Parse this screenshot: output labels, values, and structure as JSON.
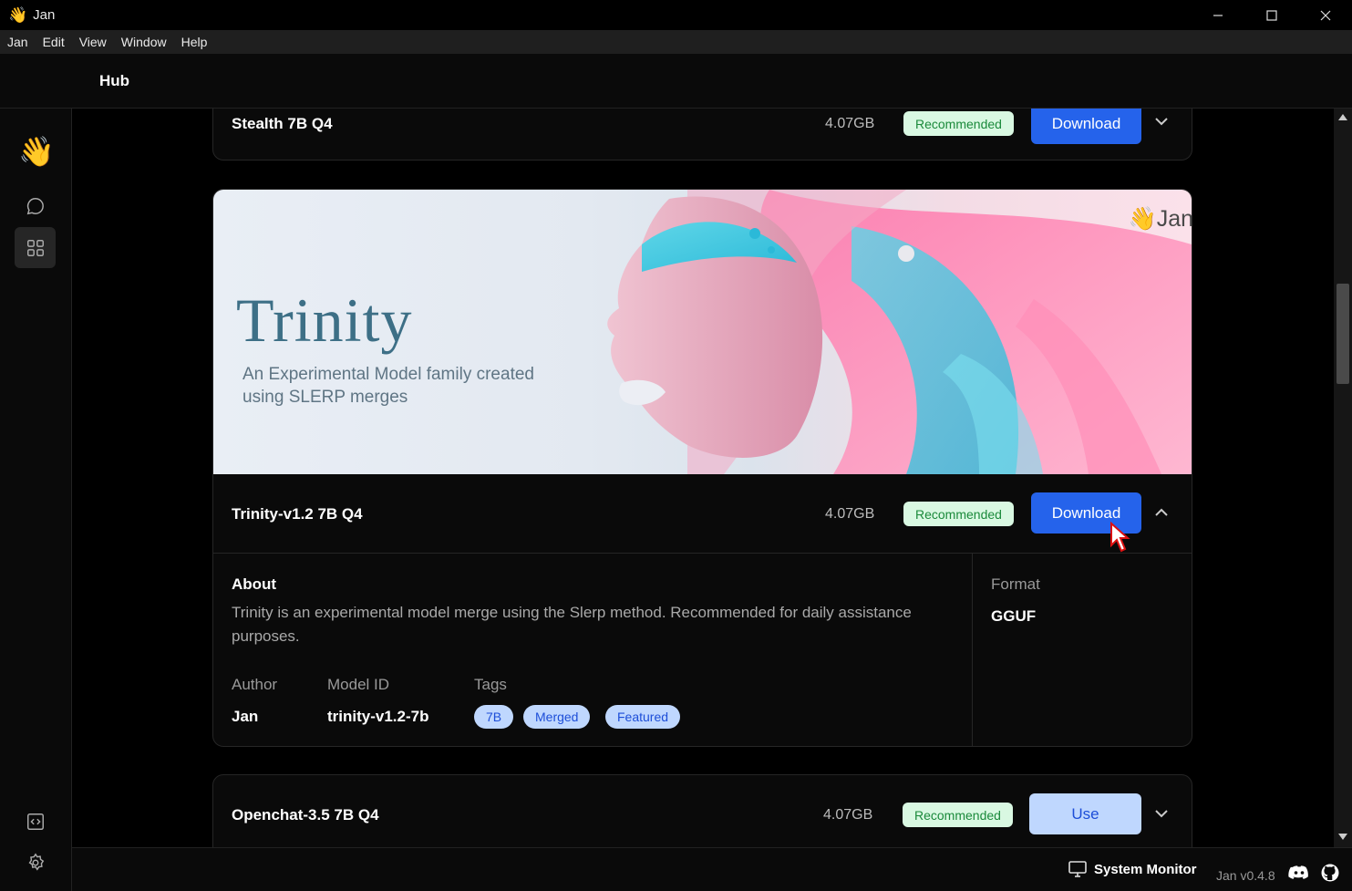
{
  "window": {
    "app_icon": "👋",
    "title": "Jan"
  },
  "menu": [
    "Jan",
    "Edit",
    "View",
    "Window",
    "Help"
  ],
  "header": {
    "title": "Hub"
  },
  "sidebar": {
    "logo": "👋",
    "items": [
      "chat-icon",
      "hub-grid-icon"
    ],
    "bottom": [
      "api-server-icon",
      "settings-gear-icon"
    ]
  },
  "models": [
    {
      "name": "Stealth 7B Q4",
      "size": "4.07GB",
      "badge": "Recommended",
      "action": "Download"
    },
    {
      "name": "Trinity-v1.2 7B Q4",
      "size": "4.07GB",
      "badge": "Recommended",
      "action": "Download"
    },
    {
      "name": "Openchat-3.5 7B Q4",
      "size": "4.07GB",
      "badge": "Recommended",
      "action": "Use"
    }
  ],
  "banner": {
    "title": "Trinity",
    "subtitle": "An Experimental Model family created using SLERP merges",
    "logo_emoji": "👋",
    "logo_text": "Jan"
  },
  "detail": {
    "about_label": "About",
    "about_text": "Trinity is an experimental model merge using the Slerp method. Recommended for daily assistance purposes.",
    "author_label": "Author",
    "author": "Jan",
    "model_id_label": "Model ID",
    "model_id": "trinity-v1.2-7b",
    "tags_label": "Tags",
    "tags": [
      "7B",
      "Merged",
      "Featured"
    ],
    "format_label": "Format",
    "format": "GGUF"
  },
  "footer": {
    "system_monitor": "System Monitor",
    "version": "Jan v0.4.8"
  },
  "colors": {
    "primary": "#2563eb",
    "badge_bg": "#d9f8e2",
    "badge_text": "#1b8a3b",
    "tag_bg": "#bfd7fe"
  }
}
